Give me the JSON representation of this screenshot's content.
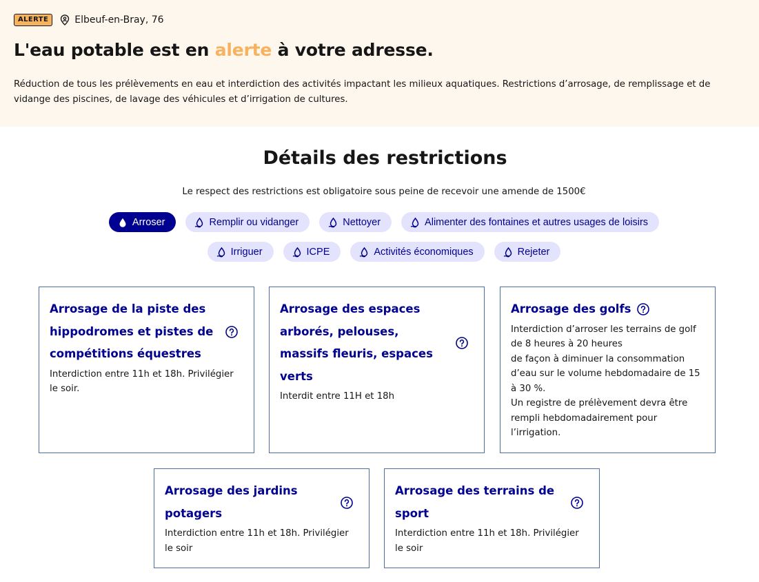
{
  "header": {
    "badge": "ALERTE",
    "location": "Elbeuf-en-Bray, 76",
    "title_before": "L'eau potable est en ",
    "title_highlight": "alerte",
    "title_after": " à votre adresse.",
    "description": "Réduction de tous les prélèvements en eau et interdiction des activités impactant les milieux aquatiques. Restrictions d’arrosage, de remplissage et de vidange des piscines, de lavage des véhicules et d’irrigation de cultures."
  },
  "section": {
    "title": "Détails des restrictions",
    "subtitle": "Le respect des restrictions est obligatoire sous peine de recevoir une amende de 1500€"
  },
  "tabs": [
    {
      "label": "Arroser",
      "active": true
    },
    {
      "label": "Remplir ou vidanger",
      "active": false
    },
    {
      "label": "Nettoyer",
      "active": false
    },
    {
      "label": "Alimenter des fontaines et autres usages de loisirs",
      "active": false
    },
    {
      "label": "Irriguer",
      "active": false
    },
    {
      "label": "ICPE",
      "active": false
    },
    {
      "label": "Activités économiques",
      "active": false
    },
    {
      "label": "Rejeter",
      "active": false
    }
  ],
  "cards": [
    {
      "title": "Arrosage de la piste des hippodromes et pistes de compétitions équestres",
      "text": "Interdiction entre 11h et 18h. Privilégier le soir."
    },
    {
      "title": "Arrosage des espaces arborés, pelouses, massifs fleuris, espaces verts",
      "text": "Interdit entre 11H et 18h"
    },
    {
      "title": "Arrosage des golfs",
      "text": "Interdiction d’arroser les terrains de golf de 8 heures à 20 heures\nde façon à diminuer la consommation d’eau sur le volume hebdomadaire de 15 à 30 %.\nUn registre de prélèvement devra être rempli hebdomadairement pour l’irrigation."
    },
    {
      "title": "Arrosage des jardins potagers",
      "text": "Interdiction entre 11h et 18h. Privilégier le soir"
    },
    {
      "title": "Arrosage des terrains de sport",
      "text": "Interdiction entre 11h et 18h. Privilégier le soir"
    }
  ],
  "icons": {
    "location": "map-pin-user-icon",
    "tab": "water-drop-icon",
    "help": "question-circle-icon"
  },
  "colors": {
    "primary": "#000091",
    "tab_bg": "#e3e3fd",
    "alert": "#f7b25e",
    "hero_bg": "#fef7ee",
    "card_border": "#4d6ea5"
  }
}
